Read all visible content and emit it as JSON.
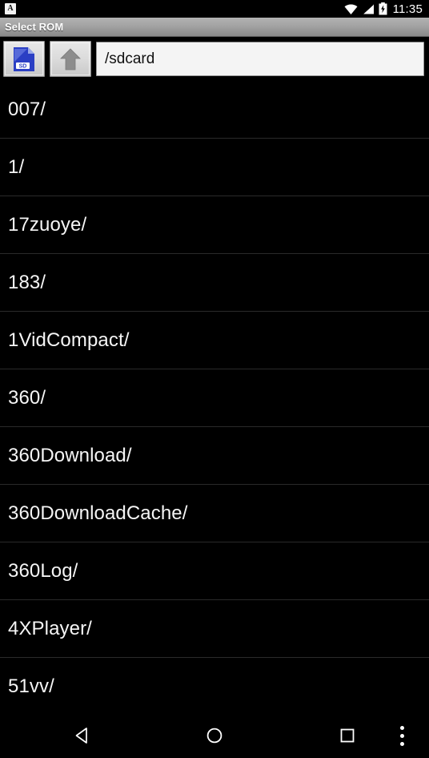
{
  "statusbar": {
    "notification_icon": "app-notification-icon",
    "notification_letter": "A",
    "wifi_icon": "wifi-icon",
    "signal_icon": "cellular-signal-icon",
    "battery_icon": "battery-charging-icon",
    "clock": "11:35"
  },
  "titlebar": {
    "title": "Select ROM"
  },
  "toolbar": {
    "sdcard_button": {
      "icon": "sdcard-icon",
      "label": "SD"
    },
    "up_button": {
      "icon": "arrow-up-icon"
    },
    "path_input": {
      "value": "/sdcard",
      "placeholder": "/sdcard"
    }
  },
  "filelist": {
    "items": [
      {
        "name": "007/"
      },
      {
        "name": "1/"
      },
      {
        "name": "17zuoye/"
      },
      {
        "name": "183/"
      },
      {
        "name": "1VidCompact/"
      },
      {
        "name": "360/"
      },
      {
        "name": "360Download/"
      },
      {
        "name": "360DownloadCache/"
      },
      {
        "name": "360Log/"
      },
      {
        "name": "4XPlayer/"
      },
      {
        "name": "51vv/"
      }
    ]
  },
  "navbar": {
    "back": "back-icon",
    "home": "home-icon",
    "recents": "recents-icon",
    "more": "overflow-menu-icon"
  },
  "colors": {
    "background": "#000000",
    "titlebar_top": "#b2b2b2",
    "titlebar_bottom": "#898989",
    "text_primary": "#f5f5f5",
    "sdcard_blue": "#2b3fc4",
    "divider": "#2a2a2a"
  }
}
